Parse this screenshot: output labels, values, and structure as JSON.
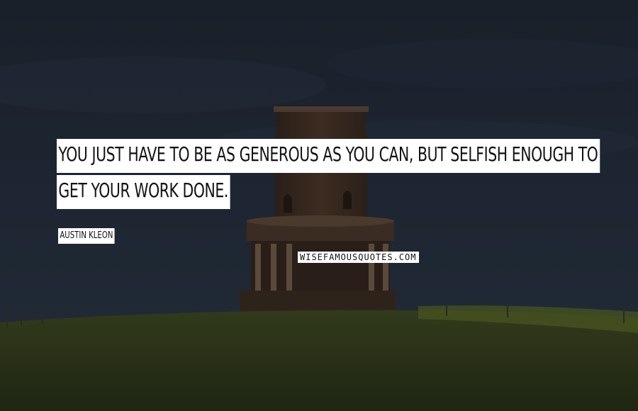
{
  "quote": {
    "lines": [
      "YOU JUST HAVE TO BE AS GENEROUS AS YOU CAN, BUT SELFISH ENOUGH TO",
      "GET YOUR WORK DONE."
    ],
    "author": "AUSTIN KLEON"
  },
  "watermark": "WISEFAMOUSQUOTES.COM",
  "colors": {
    "sky": "#1b2330",
    "hill": "#2b3318",
    "tower": "#3a2a20",
    "label_bg": "#ffffff",
    "label_text": "#111111"
  }
}
